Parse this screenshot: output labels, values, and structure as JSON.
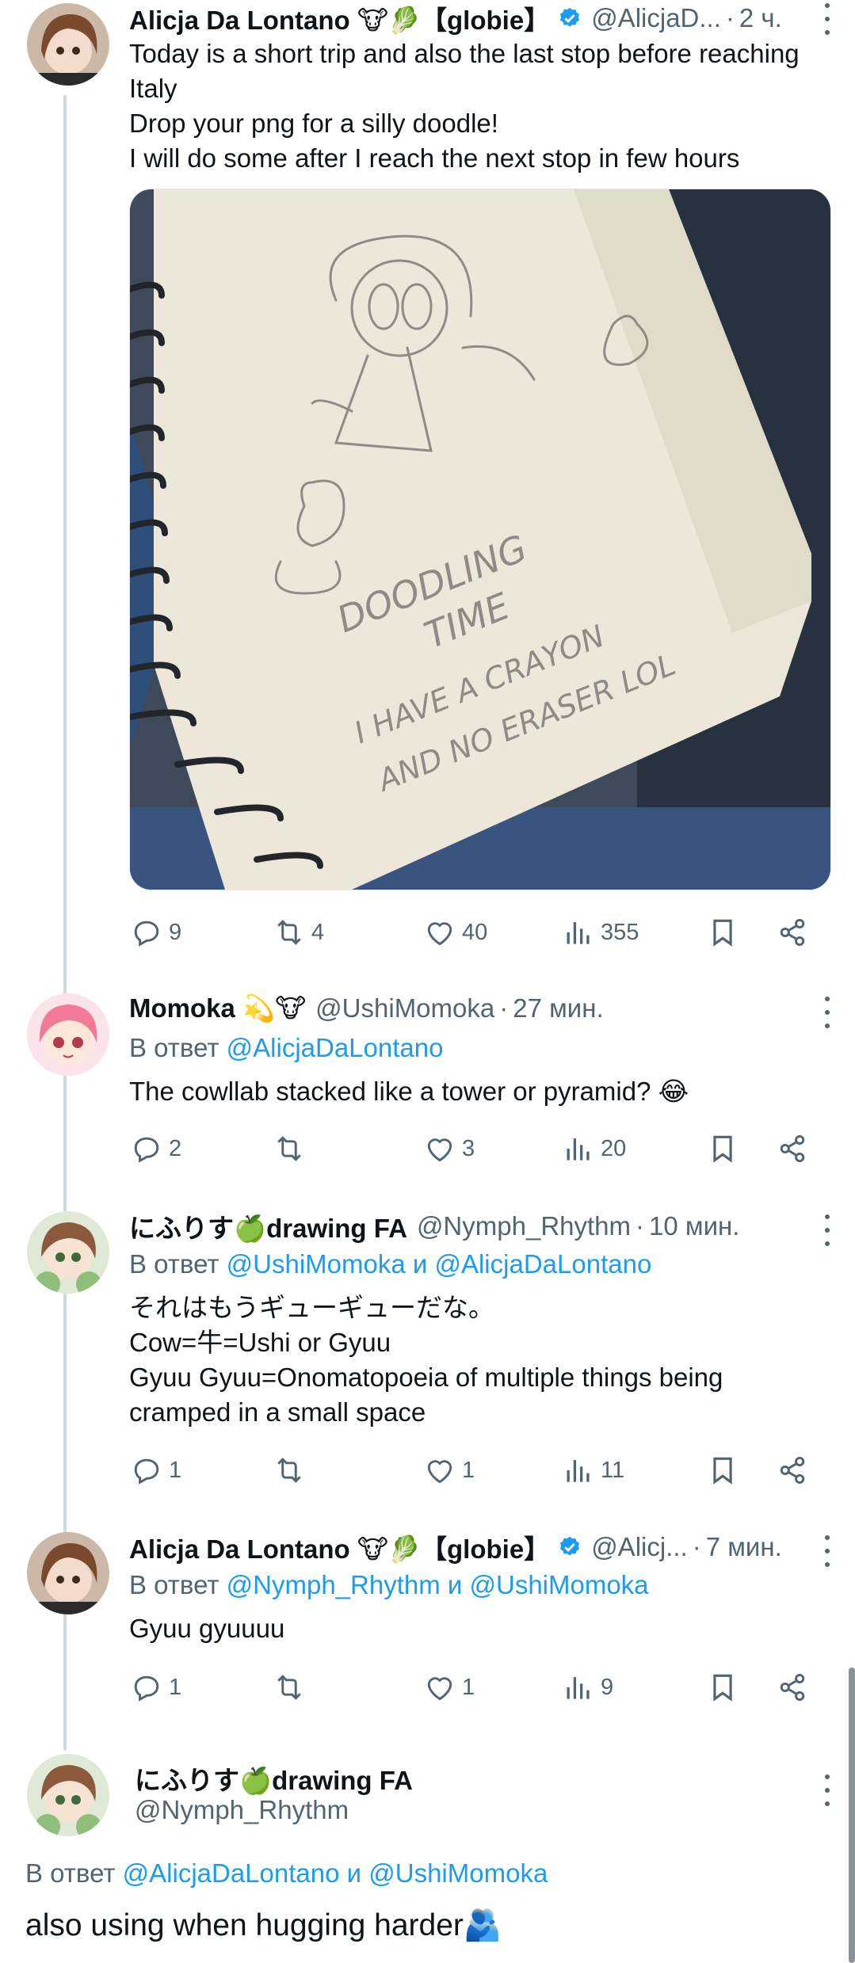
{
  "tweets": [
    {
      "name": "Alicja Da Lontano 🐮🥬【globie】",
      "handle": "@AlicjaD...",
      "time": "2 ч.",
      "verified": true,
      "lines": [
        "Today is a short trip and also the last stop before reaching",
        "Italy",
        "Drop your png for a silly doodle!",
        "I will do some after I reach the next stop in few hours"
      ],
      "media_text": [
        "DOODLING",
        "TIME",
        "I HAVE A CRAYON",
        "AND NO ERASER LOL"
      ],
      "actions": {
        "replies": "9",
        "reposts": "4",
        "likes": "40",
        "views": "355"
      }
    },
    {
      "name": "Momoka 💫🐮",
      "handle": "@UshiMomoka",
      "time": "27 мин.",
      "reply_prefix": "В ответ",
      "reply_mentions": "@AlicjaDaLontano",
      "lines": [
        "The cowllab stacked like a tower or pyramid? 😂"
      ],
      "actions": {
        "replies": "2",
        "reposts": "",
        "likes": "3",
        "views": "20"
      }
    },
    {
      "name": "にふりす🍏drawing FA",
      "handle": "@Nymph_Rhythm",
      "time": "10 мин.",
      "reply_prefix": "В ответ",
      "reply_mentions": "@UshiMomoka и @AlicjaDaLontano",
      "lines": [
        "それはもうギューギューだな。",
        "Cow=牛=Ushi or Gyuu",
        "Gyuu Gyuu=Onomatopoeia of multiple things being",
        "cramped in a small space"
      ],
      "actions": {
        "replies": "1",
        "reposts": "",
        "likes": "1",
        "views": "11"
      }
    },
    {
      "name": "Alicja Da Lontano 🐮🥬【globie】",
      "handle": "@Alicj...",
      "time": "7 мин.",
      "verified": true,
      "reply_prefix": "В ответ",
      "reply_mentions": "@Nymph_Rhythm и @UshiMomoka",
      "lines": [
        "Gyuu gyuuuu"
      ],
      "actions": {
        "replies": "1",
        "reposts": "",
        "likes": "1",
        "views": "9"
      }
    }
  ],
  "focused": {
    "name": "にふりす🍏drawing FA",
    "handle": "@Nymph_Rhythm",
    "reply_prefix": "В ответ",
    "reply_mentions": "@AlicjaDaLontano и @UshiMomoka",
    "text": "also using when hugging harder🫂"
  },
  "colors": {
    "accent": "#1d9bf0",
    "secondary": "#536471",
    "thread": "#cfd9de"
  }
}
